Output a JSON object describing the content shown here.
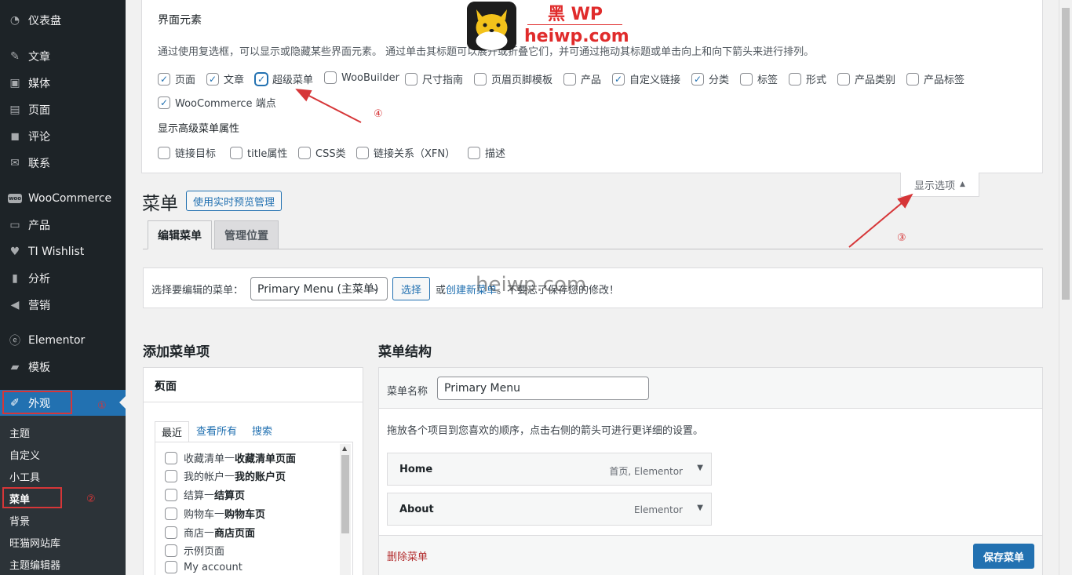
{
  "sidebar": {
    "items": [
      {
        "label": "仪表盘",
        "icon": "dashboard-icon"
      },
      {
        "label": "文章",
        "icon": "pin-icon"
      },
      {
        "label": "媒体",
        "icon": "media-icon"
      },
      {
        "label": "页面",
        "icon": "page-icon"
      },
      {
        "label": "评论",
        "icon": "comment-icon"
      },
      {
        "label": "联系",
        "icon": "mail-icon"
      },
      {
        "label": "WooCommerce",
        "icon": "woo-icon",
        "badge": "woo"
      },
      {
        "label": "产品",
        "icon": "archive-icon"
      },
      {
        "label": "TI Wishlist",
        "icon": "heart-icon"
      },
      {
        "label": "分析",
        "icon": "chart-icon"
      },
      {
        "label": "营销",
        "icon": "megaphone-icon"
      },
      {
        "label": "Elementor",
        "icon": "elementor-icon"
      },
      {
        "label": "模板",
        "icon": "folder-icon"
      },
      {
        "label": "外观",
        "icon": "brush-icon"
      }
    ],
    "submenu": [
      "主题",
      "自定义",
      "小工具",
      "菜单",
      "背景",
      "旺猫网站库",
      "主题编辑器"
    ]
  },
  "annotations": {
    "n1": "①",
    "n2": "②",
    "n3": "③",
    "n4": "④"
  },
  "screen_options": {
    "heading": "界面元素",
    "description": "通过使用复选框，可以显示或隐藏某些界面元素。 通过单击其标题可以展开或折叠它们，并可通过拖动其标题或单击向上和向下箭头来进行排列。",
    "elements": [
      {
        "label": "页面",
        "checked": true
      },
      {
        "label": "文章",
        "checked": true
      },
      {
        "label": "超级菜单",
        "checked": true
      },
      {
        "label": "WooBuilder",
        "checked": false
      },
      {
        "label": "尺寸指南",
        "checked": false
      },
      {
        "label": "页眉页脚模板",
        "checked": false
      },
      {
        "label": "产品",
        "checked": false
      },
      {
        "label": "自定义链接",
        "checked": true
      },
      {
        "label": "分类",
        "checked": true
      },
      {
        "label": "标签",
        "checked": false
      },
      {
        "label": "形式",
        "checked": false
      },
      {
        "label": "产品类别",
        "checked": false
      },
      {
        "label": "产品标签",
        "checked": false
      },
      {
        "label": "WooCommerce 端点",
        "checked": true
      }
    ],
    "advanced_heading": "显示高级菜单属性",
    "advanced": [
      {
        "label": "链接目标",
        "checked": false
      },
      {
        "label": "title属性",
        "checked": false
      },
      {
        "label": "CSS类",
        "checked": false
      },
      {
        "label": "链接关系（XFN）",
        "checked": false
      },
      {
        "label": "描述",
        "checked": false
      }
    ],
    "toggle_label": "显示选项"
  },
  "page": {
    "title": "菜单",
    "live_preview": "使用实时预览管理",
    "tabs": [
      "编辑菜单",
      "管理位置"
    ],
    "select_label": "选择要编辑的菜单：",
    "select_value": "Primary Menu (主菜单)",
    "select_button": "选择",
    "or_text": "或",
    "create_link": "创建新菜单",
    "after_text": "。不要忘了保存您的修改！"
  },
  "add_items": {
    "title": "添加菜单项",
    "panel_title": "页面",
    "tabs": [
      "最近",
      "查看所有",
      "搜索"
    ],
    "pages": [
      {
        "name": "收藏清单",
        "tag": "收藏清单页面"
      },
      {
        "name": "我的帐户",
        "tag": "我的账户页"
      },
      {
        "name": "结算",
        "tag": "结算页"
      },
      {
        "name": "购物车",
        "tag": "购物车页"
      },
      {
        "name": "商店",
        "tag": "商店页面"
      },
      {
        "name": "示例页面",
        "tag": ""
      },
      {
        "name": "My account",
        "tag": ""
      }
    ],
    "sep": " — "
  },
  "structure": {
    "title": "菜单结构",
    "name_label": "菜单名称",
    "name_value": "Primary Menu",
    "hint": "拖放各个项目到您喜欢的顺序，点击右侧的箭头可进行更详细的设置。",
    "items": [
      {
        "title": "Home",
        "meta": "首页, Elementor"
      },
      {
        "title": "About",
        "meta": "Elementor"
      }
    ],
    "delete": "删除菜单",
    "save": "保存菜单"
  },
  "watermark": {
    "brand": "黑 WP",
    "domain": "heiwp.com",
    "center": "heiwp.com"
  },
  "colors": {
    "accent": "#2271b1",
    "sidebar": "#1d2327",
    "annotation": "#d63638"
  }
}
